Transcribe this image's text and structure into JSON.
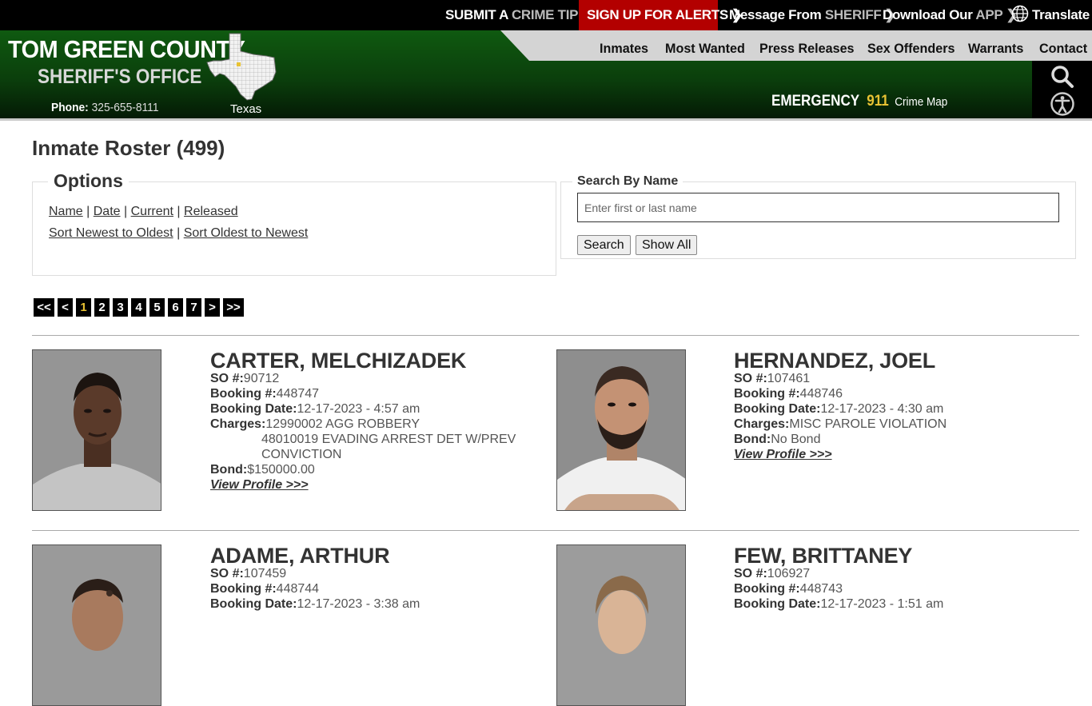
{
  "topbar": {
    "crime_tip_a": "SUBMIT A",
    "crime_tip_b": "CRIME TIP",
    "alerts": "SIGN UP FOR ALERTS",
    "sheriff_a": "Message From",
    "sheriff_b": "SHERIFF",
    "app_a": "Download Our",
    "app_b": "APP",
    "translate": "Translate"
  },
  "brand": {
    "line1": "TOM GREEN COUNTY",
    "line2": "SHERIFF'S OFFICE",
    "phone_label": "Phone:",
    "phone_number": "325-655-8111",
    "state": "Texas"
  },
  "nav": [
    "Inmates",
    "Most Wanted",
    "Press Releases",
    "Sex Offenders",
    "Warrants",
    "Contact"
  ],
  "emergency": {
    "label": "EMERGENCY",
    "number": "911",
    "crime_map": "Crime Map"
  },
  "page_title": "Inmate Roster (499)",
  "options": {
    "legend": "Options",
    "sort_links": [
      "Name",
      "Date",
      "Current",
      "Released"
    ],
    "order_links": [
      "Sort Newest to Oldest",
      "Sort Oldest to Newest"
    ],
    "separator": "|"
  },
  "search": {
    "legend": "Search By Name",
    "placeholder": "Enter first or last name",
    "search_button": "Search",
    "show_all_button": "Show All"
  },
  "pagination": {
    "first": "<<",
    "prev": "<",
    "pages": [
      "1",
      "2",
      "3",
      "4",
      "5",
      "6",
      "7"
    ],
    "current": "1",
    "next": ">",
    "last": ">>"
  },
  "labels": {
    "so": "SO #:",
    "booking": "Booking #:",
    "booking_date": "Booking Date:",
    "charges": "Charges:",
    "bond": "Bond:",
    "view_profile": "View Profile >>>"
  },
  "inmates": [
    {
      "name": "CARTER, MELCHIZADEK",
      "so": "90712",
      "booking": "448747",
      "booking_date": "12-17-2023 - 4:57 am",
      "charges": [
        "12990002 AGG ROBBERY",
        "48010019 EVADING ARREST DET W/PREV",
        "CONVICTION"
      ],
      "bond": "$150000.00"
    },
    {
      "name": "HERNANDEZ, JOEL",
      "so": "107461",
      "booking": "448746",
      "booking_date": "12-17-2023 - 4:30 am",
      "charges": [
        "MISC PAROLE VIOLATION"
      ],
      "bond": "No Bond"
    },
    {
      "name": "ADAME, ARTHUR",
      "so": "107459",
      "booking": "448744",
      "booking_date": "12-17-2023 - 3:38 am"
    },
    {
      "name": "FEW, BRITTANEY",
      "so": "106927",
      "booking": "448743",
      "booking_date": "12-17-2023 - 1:51 am"
    }
  ],
  "colors": {
    "header_green": "#0b3f0c",
    "alert_red": "#b30000",
    "accent_gold": "#e8c233",
    "pager_bg": "#000000"
  }
}
